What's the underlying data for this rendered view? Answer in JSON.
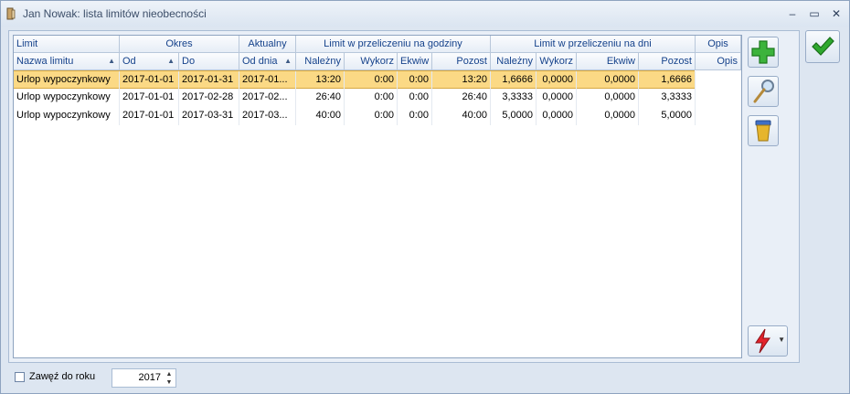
{
  "window": {
    "title": "Jan Nowak: lista limitów nieobecności"
  },
  "titlebar_buttons": {
    "minimize": "–",
    "maximize": "▭",
    "close": "✕"
  },
  "headers_top": {
    "limit": "Limit",
    "okres": "Okres",
    "aktualny": "Aktualny",
    "godziny": "Limit w przeliczeniu na godziny",
    "dni": "Limit w przeliczeniu na dni",
    "opis": "Opis"
  },
  "headers": {
    "nazwa": "Nazwa limitu",
    "od": "Od",
    "do": "Do",
    "od_dnia": "Od dnia",
    "h_nalezny": "Należny",
    "h_wykorz": "Wykorz",
    "h_ekwiw": "Ekwiw",
    "h_pozost": "Pozost",
    "d_nalezny": "Należny",
    "d_wykorz": "Wykorz",
    "d_ekwiw": "Ekwiw",
    "d_pozost": "Pozost",
    "opis": "Opis"
  },
  "rows": [
    {
      "nazwa": "Urlop wypoczynkowy",
      "od": "2017-01-01",
      "do": "2017-01-31",
      "od_dnia": "2017-01...",
      "h_nalezny": "13:20",
      "h_wykorz": "0:00",
      "h_ekwiw": "0:00",
      "h_pozost": "13:20",
      "d_nalezny": "1,6666",
      "d_wykorz": "0,0000",
      "d_ekwiw": "0,0000",
      "d_pozost": "1,6666",
      "opis": ""
    },
    {
      "nazwa": "Urlop wypoczynkowy",
      "od": "2017-01-01",
      "do": "2017-02-28",
      "od_dnia": "2017-02...",
      "h_nalezny": "26:40",
      "h_wykorz": "0:00",
      "h_ekwiw": "0:00",
      "h_pozost": "26:40",
      "d_nalezny": "3,3333",
      "d_wykorz": "0,0000",
      "d_ekwiw": "0,0000",
      "d_pozost": "3,3333",
      "opis": ""
    },
    {
      "nazwa": "Urlop wypoczynkowy",
      "od": "2017-01-01",
      "do": "2017-03-31",
      "od_dnia": "2017-03...",
      "h_nalezny": "40:00",
      "h_wykorz": "0:00",
      "h_ekwiw": "0:00",
      "h_pozost": "40:00",
      "d_nalezny": "5,0000",
      "d_wykorz": "0,0000",
      "d_ekwiw": "0,0000",
      "d_pozost": "5,0000",
      "opis": ""
    }
  ],
  "side_buttons": [
    "plus-icon",
    "magnifier-icon",
    "trash-icon",
    "lightning-icon"
  ],
  "filter": {
    "label": "Zawęź do roku",
    "year": "2017"
  },
  "colors": {
    "selected_row": "#fbd985",
    "header_text": "#15428b",
    "ok_check": "#2ea82e",
    "plus": "#3cb33c"
  }
}
